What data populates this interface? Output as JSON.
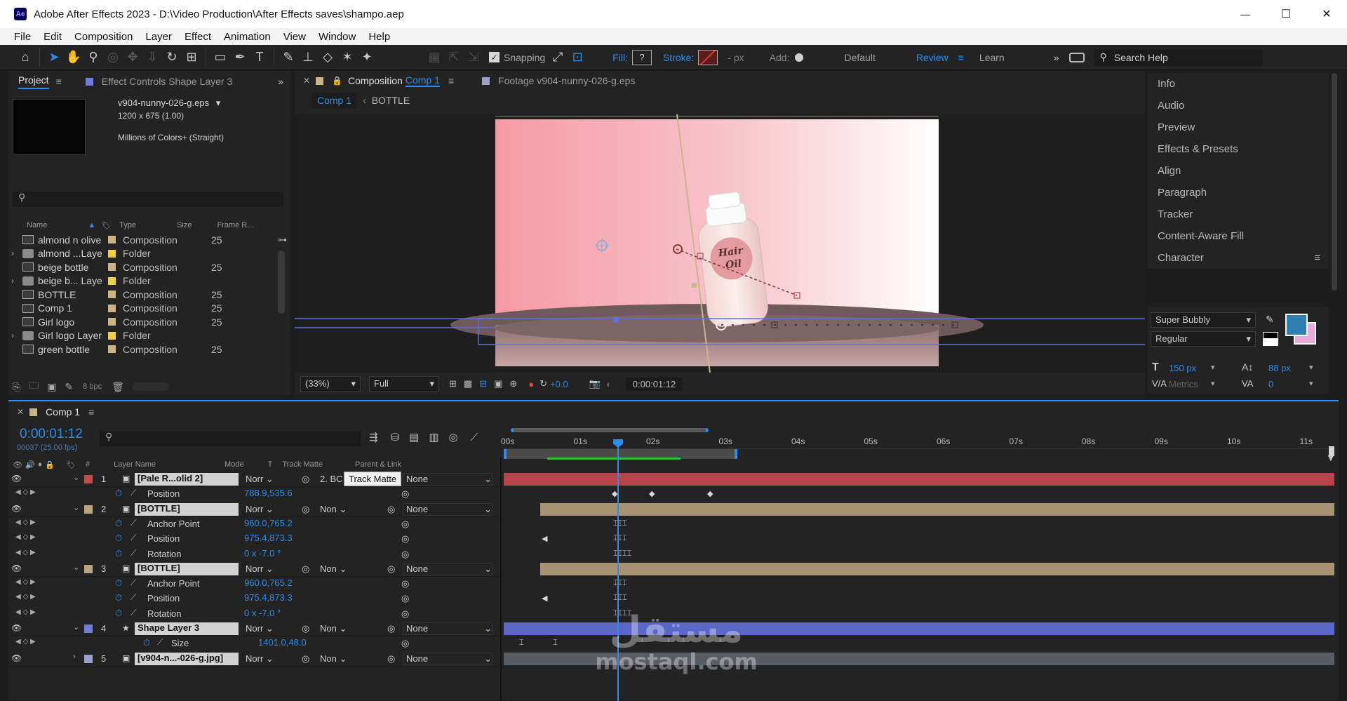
{
  "window": {
    "title": "Adobe After Effects 2023 - D:\\Video Production\\After Effects saves\\shampo.aep",
    "app_badge": "Ae",
    "minimize": "—",
    "maximize": "☐",
    "close": "✕"
  },
  "menu": [
    "File",
    "Edit",
    "Composition",
    "Layer",
    "Effect",
    "Animation",
    "View",
    "Window",
    "Help"
  ],
  "toolbar": {
    "snapping": "Snapping",
    "fill": "Fill:",
    "fill_value": "?",
    "stroke": "Stroke:",
    "stroke_px": "- px",
    "add": "Add:",
    "workspaces": [
      "Default",
      "Review",
      "Learn"
    ],
    "active_workspace": "Review",
    "search_placeholder": "Search Help"
  },
  "project": {
    "tab": "Project",
    "effect_tab": "Effect Controls Shape Layer 3",
    "file_name": "v904-nunny-026-g.eps",
    "dims": "1200 x 675 (1.00)",
    "colors": "Millions of Colors+ (Straight)",
    "columns": [
      "Name",
      "Type",
      "Size",
      "Frame R..."
    ],
    "items": [
      {
        "name": "almond n olive",
        "type": "Composition",
        "fr": "25",
        "kind": "comp",
        "color": "#cbb48a",
        "arrow": ""
      },
      {
        "name": "almond ...Layers",
        "type": "Folder",
        "fr": "",
        "kind": "folder",
        "color": "#e8d34a",
        "arrow": "›"
      },
      {
        "name": "beige bottle",
        "type": "Composition",
        "fr": "25",
        "kind": "comp",
        "color": "#cbb48a",
        "arrow": ""
      },
      {
        "name": "beige b... Layers",
        "type": "Folder",
        "fr": "",
        "kind": "folder",
        "color": "#e8d34a",
        "arrow": "›"
      },
      {
        "name": "BOTTLE",
        "type": "Composition",
        "fr": "25",
        "kind": "comp",
        "color": "#cbb48a",
        "arrow": ""
      },
      {
        "name": "Comp 1",
        "type": "Composition",
        "fr": "25",
        "kind": "comp",
        "color": "#cbb48a",
        "arrow": ""
      },
      {
        "name": "Girl logo",
        "type": "Composition",
        "fr": "25",
        "kind": "comp",
        "color": "#cbb48a",
        "arrow": ""
      },
      {
        "name": "Girl logo Layers",
        "type": "Folder",
        "fr": "",
        "kind": "folder",
        "color": "#e8d34a",
        "arrow": "›"
      },
      {
        "name": "green bottle",
        "type": "Composition",
        "fr": "25",
        "kind": "comp",
        "color": "#cbb48a",
        "arrow": ""
      }
    ],
    "bpc": "8 bpc"
  },
  "comp_viewer": {
    "tab_prefix": "Composition",
    "tab_name": "Comp 1",
    "footage_tab": "Footage  v904-nunny-026-g.eps",
    "breadcrumb": [
      "Comp 1",
      "BOTTLE"
    ],
    "zoom": "(33%)",
    "quality": "Full",
    "exposure": "+0.0",
    "timecode": "0:00:01:12",
    "bottle_label_line1": "Hair",
    "bottle_label_line2": "Oil"
  },
  "right_panels": [
    "Info",
    "Audio",
    "Preview",
    "Effects & Presets",
    "Align",
    "Paragraph",
    "Tracker",
    "Content-Aware Fill",
    "Character"
  ],
  "character": {
    "font": "Super Bubbly",
    "style": "Regular",
    "size": "150 px",
    "leading": "88 px",
    "kerning": "Metrics",
    "tracking": "0",
    "fill_color": "#2f7fb1",
    "stroke_color": "#e9a9d9"
  },
  "timeline": {
    "tab": "Comp 1",
    "timecode": "0:00:01:12",
    "fps": "00037 (25.00 fps)",
    "header": {
      "layer_name": "Layer Name",
      "mode": "Mode",
      "t": "T",
      "track_matte": "Track Matte",
      "parent": "Parent & Link"
    },
    "tooltip": "Track Matte",
    "ruler": [
      "00s",
      "01s",
      "02s",
      "03s",
      "04s",
      "05s",
      "06s",
      "07s",
      "08s",
      "09s",
      "10s",
      "11s"
    ],
    "layers": [
      {
        "num": "1",
        "name": "[Pale R...olid 2]",
        "mode": "Norr",
        "matte": "2. BC",
        "parent": "None",
        "color": "#c24b4b",
        "bar": "#b8434a",
        "props": [
          {
            "name": "Position",
            "value": "788.9,535.6"
          }
        ]
      },
      {
        "num": "2",
        "name": "[BOTTLE]",
        "mode": "Norr",
        "matte": "Non",
        "parent": "None",
        "color": "#b9a582",
        "bar": "#a89274",
        "props": [
          {
            "name": "Anchor Point",
            "value": "960.0,765.2"
          },
          {
            "name": "Position",
            "value": "975.4,873.3"
          },
          {
            "name": "Rotation",
            "value": "0 x -7.0 °"
          }
        ]
      },
      {
        "num": "3",
        "name": "[BOTTLE]",
        "mode": "Norr",
        "matte": "Non",
        "parent": "None",
        "color": "#b9a582",
        "bar": "#a89274",
        "props": [
          {
            "name": "Anchor Point",
            "value": "960.0,765.2"
          },
          {
            "name": "Position",
            "value": "975.4,873.3"
          },
          {
            "name": "Rotation",
            "value": "0 x -7.0 °"
          }
        ]
      },
      {
        "num": "4",
        "name": "Shape Layer 3",
        "mode": "Norr",
        "matte": "Non",
        "parent": "None",
        "color": "#6f7fd6",
        "bar": "#5a67c8",
        "props": [
          {
            "name": "Size",
            "value": "1401.0,48.0"
          }
        ]
      },
      {
        "num": "5",
        "name": "[v904-n...-026-g.jpg]",
        "mode": "Norr",
        "matte": "Non",
        "parent": "None",
        "color": "#9aa0c9",
        "bar": "#595c64",
        "props": []
      }
    ]
  },
  "watermark": {
    "arabic": "مستقل",
    "latin": "mostaql.com"
  }
}
